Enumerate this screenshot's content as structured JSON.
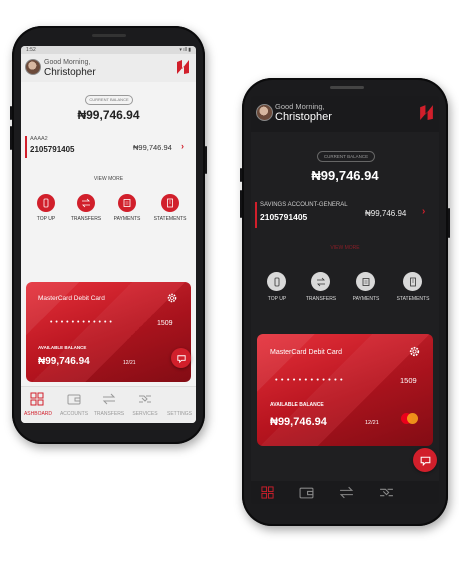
{
  "light": {
    "status": {
      "time": "1:52"
    },
    "greeting": "Good Morning,",
    "name": "Christopher",
    "balance_label": "CURRENT BALANCE",
    "balance": "₦99,746.94",
    "account": {
      "name": "AAAA2",
      "number": "2105791405",
      "amount": "₦99,746.94"
    },
    "view_more": "VIEW MORE",
    "actions": [
      "TOP UP",
      "TRANSFERS",
      "PAYMENTS",
      "STATEMENTS"
    ],
    "card": {
      "title": "MasterCard Debit Card",
      "masked": "• • • •     • • • •     • • • •",
      "last4": "1509",
      "available_label": "AVAILABLE BALANCE",
      "balance": "₦99,746.94",
      "expiry": "12/21"
    },
    "nav": [
      "ASHBOARD",
      "ACCOUNTS",
      "TRANSFERS",
      "SERVICES",
      "SETTINGS"
    ]
  },
  "dark": {
    "greeting": "Good Morning,",
    "name": "Christopher",
    "balance_label": "CURRENT BALANCE",
    "balance": "₦99,746.94",
    "account": {
      "name": "SAVINGS ACCOUNT-GENERAL",
      "number": "2105791405",
      "amount": "₦99,746.94"
    },
    "view_more": "VIEW MORE",
    "actions": [
      "TOP UP",
      "TRANSFERS",
      "PAYMENTS",
      "STATEMENTS"
    ],
    "card": {
      "title": "MasterCard Debit Card",
      "masked": "• • • •     • • • •     • • • •",
      "last4": "1509",
      "available_label": "AVAILABLE BALANCE",
      "balance": "₦99,746.94",
      "expiry": "12/21"
    }
  },
  "colors": {
    "accent": "#d11f2b",
    "dark_bg": "#1f1f21",
    "light_bg": "#f3f3f3"
  },
  "icons": [
    "logo-icon",
    "settings-gear-icon",
    "chat-icon",
    "phone-topup-icon",
    "transfer-arrows-icon",
    "payments-receipt-icon",
    "statements-doc-icon",
    "dashboard-grid-icon",
    "wallet-icon",
    "services-handshake-icon"
  ]
}
